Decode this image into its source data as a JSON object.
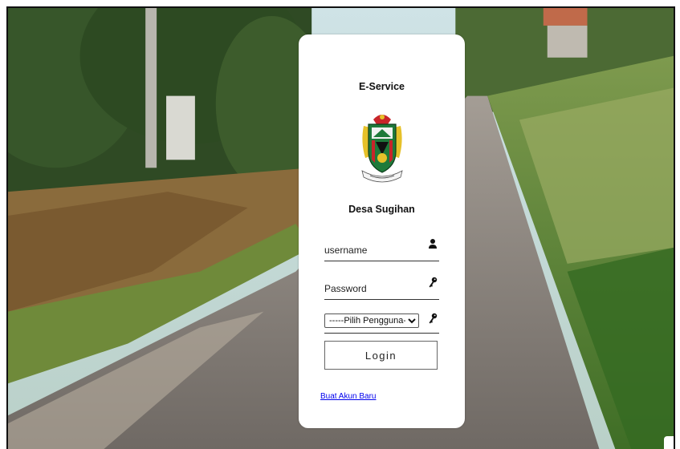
{
  "app": {
    "title": "E-Service",
    "village_name": "Desa Sugihan"
  },
  "form": {
    "username_placeholder": "username",
    "password_placeholder": "Password",
    "role_select": {
      "selected": "-----Pilih Pengguna-----",
      "options": [
        "-----Pilih Pengguna-----"
      ]
    },
    "login_label": "Login",
    "create_account_link": "Buat Akun Baru"
  },
  "icons": {
    "username": "user-icon",
    "password": "key-icon",
    "role": "key-icon",
    "emblem": "regency-emblem"
  },
  "colors": {
    "card_bg": "#ffffff",
    "link": "#0000ee",
    "emblem_green": "#1f7a3a",
    "emblem_red": "#c8242a",
    "emblem_gold": "#e6c12a"
  }
}
